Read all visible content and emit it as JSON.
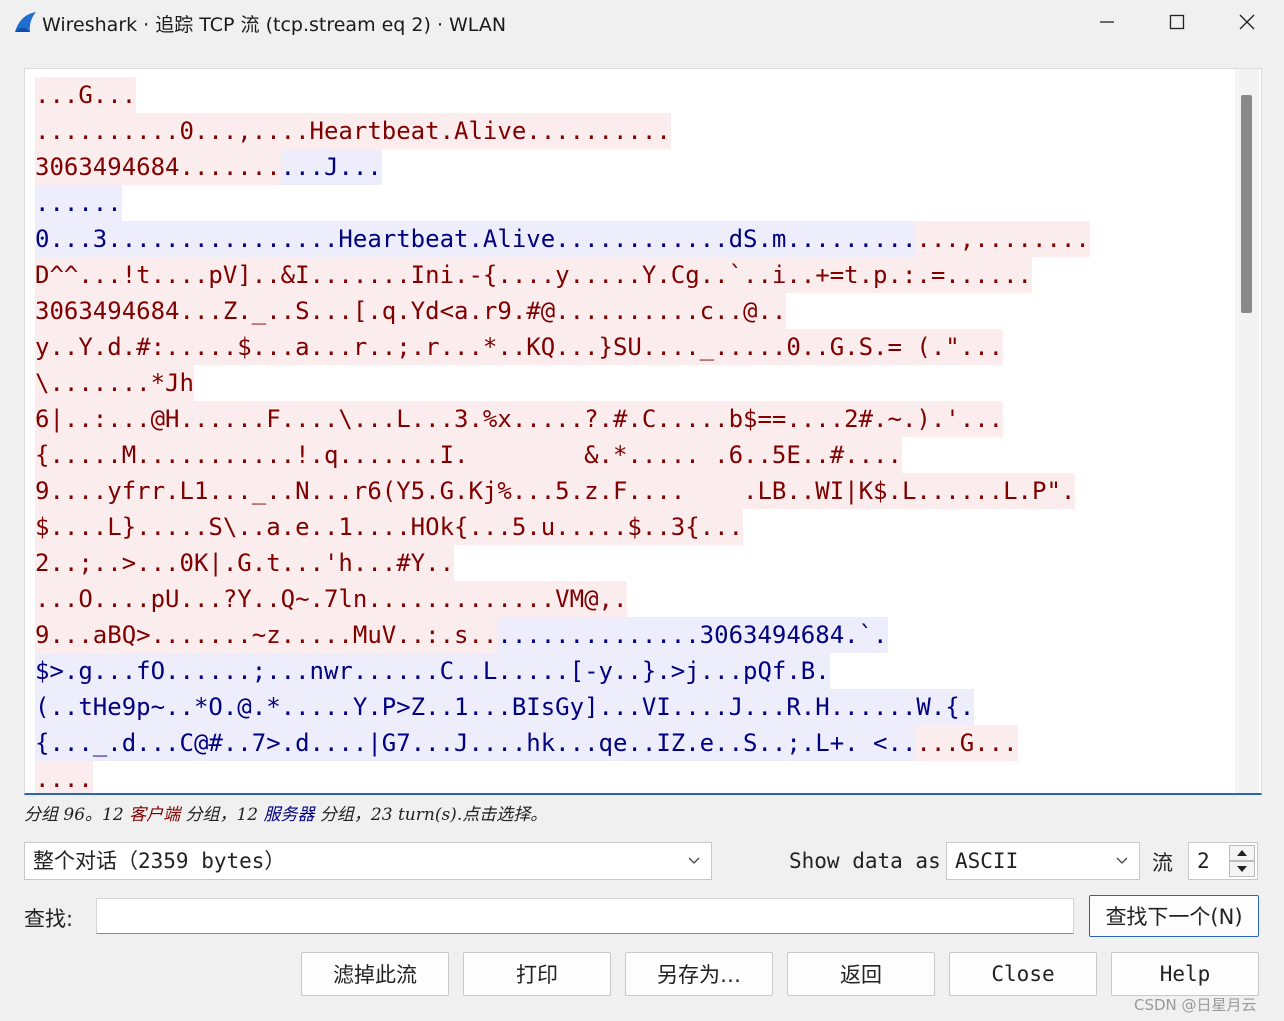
{
  "window": {
    "title": "Wireshark · 追踪 TCP 流 (tcp.stream eq 2) · WLAN",
    "icons": [
      "wireshark-fin-icon",
      "minimize-icon",
      "maximize-icon",
      "close-icon"
    ]
  },
  "colors": {
    "client_bg": "#fbeded",
    "client_fg": "#800000",
    "server_bg": "#ededfb",
    "server_fg": "#000080",
    "accent": "#2a64b8"
  },
  "stream_lines": [
    [
      {
        "t": "...G...",
        "k": "c"
      }
    ],
    [
      {
        "t": "..........0...,....Heartbeat.Alive..........",
        "k": "c"
      }
    ],
    [
      {
        "t": "3063494684.......",
        "k": "c"
      },
      {
        "t": "...J...",
        "k": "s"
      }
    ],
    [
      {
        "t": "......",
        "k": "s"
      }
    ],
    [
      {
        "t": "0...3................Heartbeat.Alive............dS.m.........",
        "k": "s"
      },
      {
        "t": "...,........",
        "k": "c"
      }
    ],
    [
      {
        "t": "D^^...!t....pV]..&I.......Ini.-{....y.....Y.Cg..`..i..+=t.p.:.=......",
        "k": "c"
      }
    ],
    [
      {
        "t": "3063494684...Z._..S...[.q.Yd<a.r9.#@..........c..@..",
        "k": "c"
      }
    ],
    [
      {
        "t": "y..Y.d.#:.....$...a...r..;.r...*..KQ...}SU...._.....0..G.S.= (.\"...",
        "k": "c"
      }
    ],
    [
      {
        "t": "\\.......*Jh",
        "k": "c"
      }
    ],
    [
      {
        "t": "6|..:...@H......F....\\...L...3.%x.....?.#.C.....b$==....2#.~.).'...",
        "k": "c"
      }
    ],
    [
      {
        "t": "{.....M...........!.q.......I.        &.*..... .6..5E..#....",
        "k": "c"
      }
    ],
    [
      {
        "t": "9....yfrr.L1..._..N...r6(Y5.G.Kj%...5.z.F....    .LB..WI|K$.L......L.P\".",
        "k": "c"
      }
    ],
    [
      {
        "t": "$....L}.....S\\..a.e..1....HOk{...5.u.....$..3{...",
        "k": "c"
      }
    ],
    [
      {
        "t": "2..;..>...0K|.G.t...'h...#Y..",
        "k": "c"
      }
    ],
    [
      {
        "t": "...O....pU...?Y..Q~.7ln.............VM@,.",
        "k": "c"
      }
    ],
    [
      {
        "t": "9...aBQ>.......~z.....MuV..:.s..",
        "k": "c"
      },
      {
        "t": "..............3063494684.`.",
        "k": "s"
      }
    ],
    [
      {
        "t": "$>.g...fO......;...nwr......C..L.....[-y..}.>j...pQf.B.",
        "k": "s"
      }
    ],
    [
      {
        "t": "(..tHe9p~..*O.@.*.....Y.P>Z..1...BIsGy]...VI....J...R.H......W.{.",
        "k": "s"
      }
    ],
    [
      {
        "t": "{..._.d...C@#..7>.d....|G7...J....hk...qe..IZ.e..S..;.L+. <..",
        "k": "s"
      },
      {
        "t": "...G...",
        "k": "c"
      }
    ],
    [
      {
        "t": "....",
        "k": "c"
      }
    ]
  ],
  "info": {
    "prefix": "分组 96。12 ",
    "client": "客户端",
    "mid": " 分组，12 ",
    "server": "服务器",
    "suffix": " 分组，23 turn(s).点击选择。"
  },
  "controls": {
    "conversation": "整个对话（2359 bytes）",
    "show_data_as_label": "Show data as",
    "show_data_as_value": "ASCII",
    "stream_label": "流",
    "stream_value": "2",
    "find_label": "查找:",
    "find_value": "",
    "find_next": "查找下一个(N)"
  },
  "buttons": {
    "filter_out": "滤掉此流",
    "print": "打印",
    "save_as": "另存为…",
    "back": "返回",
    "close": "Close",
    "help": "Help"
  },
  "watermark": "CSDN @日星月云"
}
